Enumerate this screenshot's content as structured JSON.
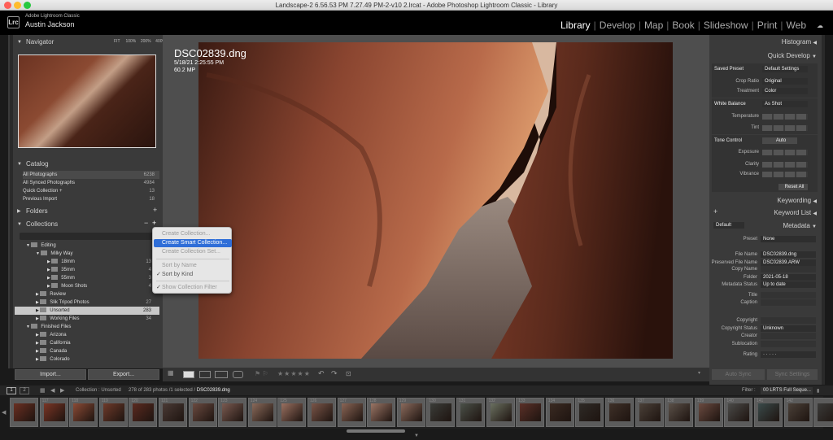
{
  "window": {
    "title": "Landscape-2 6.56.53 PM 7.27.49 PM-2-v10 2.lrcat - Adobe Photoshop Lightroom Classic - Library"
  },
  "identity": {
    "app": "Adobe Lightroom Classic",
    "user": "Austin Jackson",
    "logo": "Lrc"
  },
  "modules": [
    "Library",
    "Develop",
    "Map",
    "Book",
    "Slideshow",
    "Print",
    "Web"
  ],
  "active_module": "Library",
  "navigator": {
    "title": "Navigator",
    "zoom_options": [
      "FIT",
      "100%",
      "200%",
      "400%"
    ]
  },
  "catalog": {
    "title": "Catalog",
    "items": [
      {
        "label": "All Photographs",
        "count": "6238"
      },
      {
        "label": "All Synced Photographs",
        "count": "4984"
      },
      {
        "label": "Quick Collection +",
        "count": "13"
      },
      {
        "label": "Previous Import",
        "count": "18"
      }
    ]
  },
  "folders": {
    "title": "Folders",
    "add": "+"
  },
  "collections": {
    "title": "Collections",
    "minus": "−",
    "plus": "+",
    "items": [
      {
        "label": "Editing",
        "count": ""
      },
      {
        "label": "Milky Way",
        "count": ""
      },
      {
        "label": "18mm",
        "count": "13"
      },
      {
        "label": "35mm",
        "count": "4"
      },
      {
        "label": "55mm",
        "count": "3"
      },
      {
        "label": "Moon Shots",
        "count": "4"
      },
      {
        "label": "Review",
        "count": ""
      },
      {
        "label": "Slik Tripod Photos",
        "count": "27"
      },
      {
        "label": "Unsorted",
        "count": "283"
      },
      {
        "label": "Working Files",
        "count": "34"
      },
      {
        "label": "Finished Files",
        "count": ""
      },
      {
        "label": "Arizona",
        "count": ""
      },
      {
        "label": "California",
        "count": ""
      },
      {
        "label": "Canada",
        "count": ""
      },
      {
        "label": "Colorado",
        "count": ""
      }
    ]
  },
  "context_menu": {
    "items": [
      {
        "label": "Create Collection...",
        "state": "disabled",
        "checked": false
      },
      {
        "label": "Create Smart Collection...",
        "state": "highlighted",
        "checked": false
      },
      {
        "label": "Create Collection Set...",
        "state": "disabled",
        "checked": false
      },
      {
        "label": "Sort by Name",
        "state": "disabled",
        "checked": false
      },
      {
        "label": "Sort by Kind",
        "state": "normal",
        "checked": true
      },
      {
        "label": "Show Collection Filter",
        "state": "disabled",
        "checked": true
      }
    ]
  },
  "buttons": {
    "import": "Import...",
    "export": "Export..."
  },
  "photo_info": {
    "filename": "DSC02839.dng",
    "datetime": "5/18/21 2:25:55 PM",
    "megapixels": "60.2 MP"
  },
  "right_panel": {
    "histogram": "Histogram",
    "quick_develop": "Quick Develop",
    "saved_preset_label": "Saved Preset",
    "saved_preset_value": "Default Settings",
    "crop_ratio_label": "Crop Ratio",
    "crop_ratio_value": "Original",
    "treatment_label": "Treatment",
    "treatment_value": "Color",
    "white_balance_label": "White Balance",
    "white_balance_value": "As Shot",
    "temperature_label": "Temperature",
    "tint_label": "Tint",
    "tone_control_label": "Tone Control",
    "auto_label": "Auto",
    "exposure_label": "Exposure",
    "clarity_label": "Clarity",
    "vibrance_label": "Vibrance",
    "reset_all": "Reset All",
    "keywording": "Keywording",
    "keyword_list": "Keyword List",
    "metadata": "Metadata",
    "metadata_default": "Default",
    "preset_label": "Preset",
    "preset_value": "None",
    "fields": [
      {
        "label": "File Name",
        "value": "DSC02839.dng"
      },
      {
        "label": "Preserved File Name",
        "value": "DSC02839.ARW"
      },
      {
        "label": "Copy Name",
        "value": ""
      },
      {
        "label": "Folder",
        "value": "2021-05-18"
      },
      {
        "label": "Metadata Status",
        "value": "Up to date"
      },
      {
        "label": "Title",
        "value": ""
      },
      {
        "label": "Caption",
        "value": ""
      },
      {
        "label": "Copyright",
        "value": ""
      },
      {
        "label": "Copyright Status",
        "value": "Unknown"
      },
      {
        "label": "Creator",
        "value": ""
      },
      {
        "label": "Sublocation",
        "value": ""
      },
      {
        "label": "Rating",
        "value": "· · · · ·"
      }
    ],
    "auto_sync": "Auto Sync",
    "sync_settings": "Sync Settings"
  },
  "filmstrip": {
    "pages": [
      "1",
      "2"
    ],
    "source": "Collection : Unsorted",
    "count_text": "278 of 283 photos /1 selected /",
    "selected_file": "DSC02839.dng",
    "filter_label": "Filter :",
    "filter_value": "00 LRTS Full Seque...",
    "cells": [
      {
        "no": "",
        "color": "#6a2f22"
      },
      {
        "no": "117",
        "color": "#7a3525"
      },
      {
        "no": "118",
        "color": "#8a4a35"
      },
      {
        "no": "119",
        "color": "#6e3a2a"
      },
      {
        "no": "120",
        "color": "#5a2a20"
      },
      {
        "no": "121",
        "color": "#4a3a35"
      },
      {
        "no": "122",
        "color": "#6a4a40"
      },
      {
        "no": "123",
        "color": "#7a5a50"
      },
      {
        "no": "124",
        "color": "#8a6a5a"
      },
      {
        "no": "125",
        "color": "#9a7060"
      },
      {
        "no": "126",
        "color": "#7a5548"
      },
      {
        "no": "127",
        "color": "#8a6555"
      },
      {
        "no": "128",
        "color": "#9a7565"
      },
      {
        "no": "129",
        "color": "#8a6a5c"
      },
      {
        "no": "130",
        "color": "#3a3c38"
      },
      {
        "no": "131",
        "color": "#4a5048"
      },
      {
        "no": "132",
        "color": "#6a7060"
      },
      {
        "no": "133",
        "color": "#5a3028"
      },
      {
        "no": "134",
        "color": "#3a2a22"
      },
      {
        "no": "135",
        "color": "#2e2a26"
      },
      {
        "no": "136",
        "color": "#3e3028"
      },
      {
        "no": "137",
        "color": "#4a4038"
      },
      {
        "no": "138",
        "color": "#5a5048"
      },
      {
        "no": "139",
        "color": "#6a4a40"
      },
      {
        "no": "140",
        "color": "#4a4a48"
      },
      {
        "no": "141",
        "color": "#3a4a4a"
      },
      {
        "no": "142",
        "color": "#4a4038"
      },
      {
        "no": "",
        "color": "#3a3a38"
      }
    ]
  }
}
